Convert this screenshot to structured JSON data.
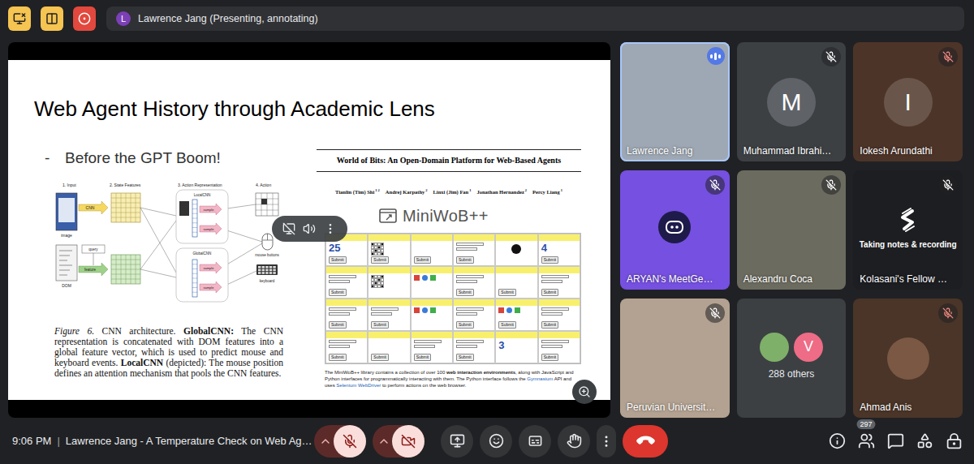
{
  "top_bar": {
    "indicators": [
      {
        "kind": "screen-off",
        "color": "#f5c451"
      },
      {
        "kind": "layout",
        "color": "#f5c451"
      },
      {
        "kind": "record",
        "color": "#e2483d"
      }
    ],
    "presenter": {
      "initial": "L",
      "label": "Lawrence Jang (Presenting, annotating)"
    }
  },
  "slide": {
    "title": "Web Agent History through Academic Lens",
    "bullet": {
      "marker": "-",
      "text": "Before the GPT Boom!"
    },
    "figure": {
      "stages": [
        "1. Input",
        "2. State Features",
        "3. Action Representation",
        "4. Action"
      ],
      "labels": {
        "image": "image",
        "dom": "DOM",
        "query": "query",
        "feature": "feature",
        "cnn": "CNN",
        "local": "LocalCNN",
        "global": "GlobalCNN",
        "sample": "sample",
        "mouse": "mouse buttons",
        "keyboard": "keyboard"
      },
      "caption": [
        {
          "text": "Figure 6.",
          "style": "italic"
        },
        {
          "text": " CNN architecture. ",
          "style": "plain"
        },
        {
          "text": "GlobalCNN:",
          "style": "bold"
        },
        {
          "text": " The CNN representation is concatenated with DOM features into a global feature vector, which is used to predict mouse and keyboard events. ",
          "style": "plain"
        },
        {
          "text": "LocalCNN",
          "style": "bold"
        },
        {
          "text": " (depicted): The mouse position defines an attention mechanism that pools the CNN features.",
          "style": "plain"
        }
      ]
    },
    "paper": {
      "title": "World of Bits: An Open-Domain Platform for Web-Based Agents",
      "authors": [
        {
          "name": "Tianlin (Tim) Shi",
          "marks": "1 2"
        },
        {
          "name": "Andrej Karpathy",
          "marks": "2"
        },
        {
          "name": "Linxi (Jim) Fan",
          "marks": "1"
        },
        {
          "name": "Jonathan Hernandez",
          "marks": "2"
        },
        {
          "name": "Percy Liang",
          "marks": "1"
        }
      ],
      "logo": "MiniWoB++",
      "grid": {
        "button": "Submit",
        "cells": [
          {
            "kind": "digits",
            "glyph": "25",
            "button": true
          },
          {
            "kind": "checker",
            "button": true
          },
          {
            "kind": "blank",
            "button": true
          },
          {
            "kind": "form",
            "button": true
          },
          {
            "kind": "dot",
            "button": false
          },
          {
            "kind": "digits",
            "glyph": "4",
            "button": true
          },
          {
            "kind": "form",
            "button": true
          },
          {
            "kind": "checker",
            "button": false
          },
          {
            "kind": "shapes",
            "button": false
          },
          {
            "kind": "form",
            "button": true
          },
          {
            "kind": "blank",
            "button": true
          },
          {
            "kind": "form",
            "button": true
          },
          {
            "kind": "form",
            "button": true
          },
          {
            "kind": "form",
            "button": true
          },
          {
            "kind": "shapes",
            "button": false
          },
          {
            "kind": "form",
            "button": true
          },
          {
            "kind": "shapes",
            "button": true
          },
          {
            "kind": "form",
            "button": true
          },
          {
            "kind": "form",
            "button": true
          },
          {
            "kind": "blank",
            "button": true
          },
          {
            "kind": "form",
            "button": true
          },
          {
            "kind": "form",
            "button": true
          },
          {
            "kind": "digits",
            "glyph": "3",
            "button": false
          },
          {
            "kind": "form",
            "button": true
          }
        ]
      },
      "caption": [
        {
          "text": "The MiniWoB++ library contains a collection of over 100 ",
          "style": "plain"
        },
        {
          "text": "web interaction environments",
          "style": "bold"
        },
        {
          "text": ", along with JavaScript and Python interfaces for programmatically interacting with them. The Python interface follows the ",
          "style": "plain"
        },
        {
          "text": "Gymnasium",
          "style": "link"
        },
        {
          "text": " API and uses ",
          "style": "plain"
        },
        {
          "text": "Selenium WebDriver",
          "style": "link"
        },
        {
          "text": " to perform actions on the web browser.",
          "style": "plain"
        }
      ]
    }
  },
  "participants": [
    {
      "name": "Lawrence Jang",
      "kind": "video",
      "color": "#9ea8b4",
      "muted": false,
      "speaking": true
    },
    {
      "name": "Muhammad Ibrahi…",
      "kind": "avatar",
      "initial": "M",
      "color": "#3c4043",
      "avatar_color": "#5f6368",
      "muted": true,
      "badge_color": "#ffffff",
      "speaking": false
    },
    {
      "name": "Iokesh Arundathi",
      "kind": "avatar",
      "initial": "I",
      "color": "#4d3429",
      "avatar_color": "#6a554b",
      "muted": true,
      "badge_color": "#f28b82",
      "speaking": false
    },
    {
      "name": "ARYAN's MeetGe…",
      "kind": "logo-bot",
      "color": "#7650e0",
      "muted": true,
      "badge_color": "#ffffff",
      "speaking": false
    },
    {
      "name": "Alexandru Coca",
      "kind": "video",
      "color": "#6c6b5f",
      "muted": true,
      "badge_color": "#ffffff",
      "speaking": false
    },
    {
      "name": "Kolasani's Fellow …",
      "kind": "logo-notes",
      "extra": "Taking notes & recording",
      "color": "#1d1e21",
      "muted": true,
      "badge_color": "#ffffff",
      "speaking": false
    },
    {
      "name": "Peruvian Universit…",
      "kind": "video",
      "color": "#b3a291",
      "muted": true,
      "badge_color": "#ffffff",
      "speaking": false
    },
    {
      "name": "288 others",
      "kind": "others",
      "color": "#3c4043",
      "avatars": [
        {
          "kind": "photo",
          "color": "#7fb069"
        },
        {
          "kind": "letter",
          "initial": "V",
          "color": "#ee6c86"
        }
      ],
      "muted": false,
      "speaking": false
    },
    {
      "name": "Ahmad Anis",
      "kind": "photo",
      "color": "#4a3528",
      "avatar_color": "#7a5844",
      "muted": true,
      "badge_color": "#f28b82",
      "speaking": false
    }
  ],
  "bottom_bar": {
    "time": "9:06 PM",
    "separator": "|",
    "meeting": "Lawrence Jang - A Temperature Check on Web Ag…",
    "mic_on": false,
    "camera_on": false,
    "people_count": "297"
  }
}
